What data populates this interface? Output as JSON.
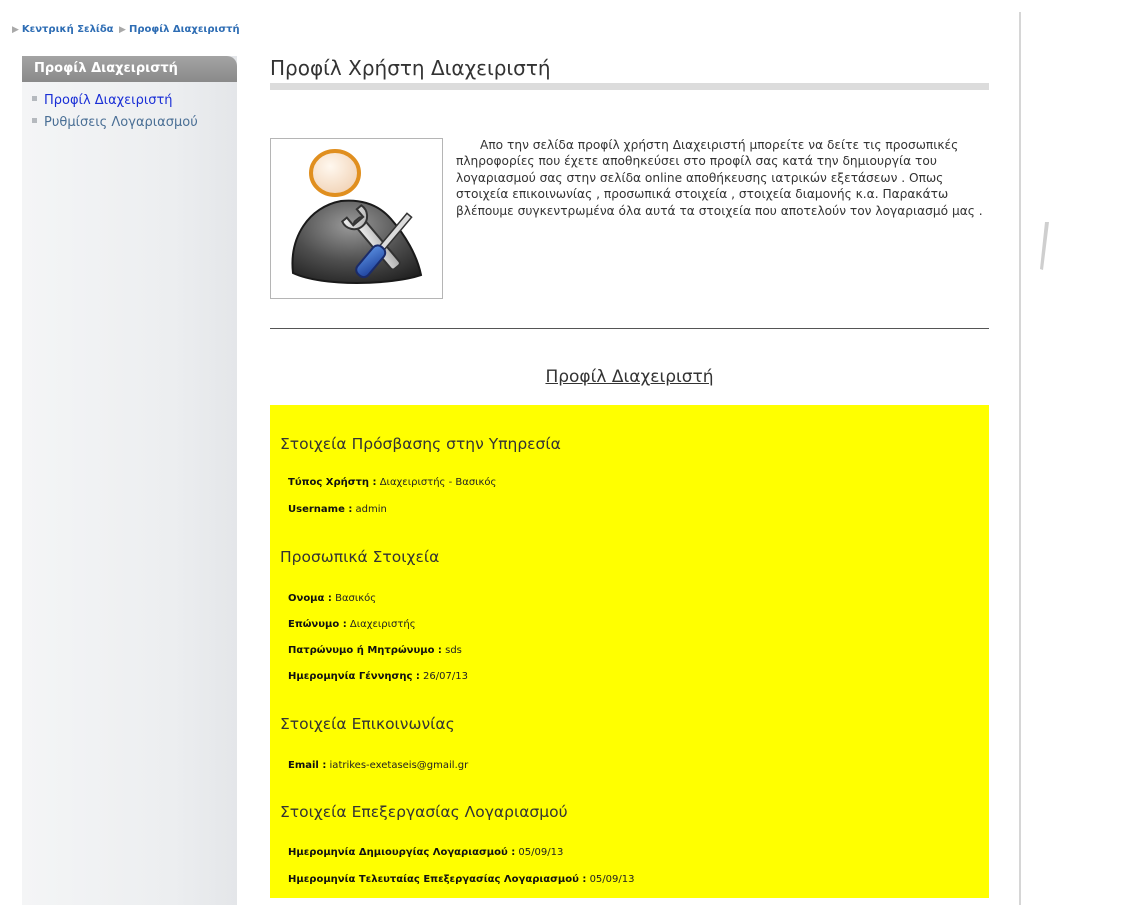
{
  "breadcrumb": {
    "items": [
      "Κεντρική Σελίδα",
      "Προφίλ Διαχειριστή"
    ]
  },
  "sidebar": {
    "title": "Προφίλ Διαχειριστή",
    "items": [
      {
        "label": "Προφίλ Διαχειριστή",
        "active": true
      },
      {
        "label": "Ρυθμίσεις Λογαριασμού",
        "active": false
      }
    ]
  },
  "main": {
    "title": "Προφίλ Χρήστη Διαχειριστή",
    "avatar_icon": "admin-user-tools-icon",
    "intro": "Απο την σελίδα προφίλ χρήστη Διαχειριστή μπορείτε να δείτε τις προσωπικές πληροφορίες που έχετε αποθηκεύσει στο προφίλ σας κατά την δημιουργία του λογαριασμού σας στην σελίδα online αποθήκευσης ιατρικών εξετάσεων . Οπως στοιχεία επικοινωνίας , προσωπικά στοιχεία , στοιχεία διαμονής κ.α. Παρακάτω βλέπουμε συγκεντρωμένα όλα αυτά τα στοιχεία που αποτελούν τον λογαριασμό μας .",
    "profile_heading": "Προφίλ Διαχειριστή"
  },
  "profile": {
    "access": {
      "title": "Στοιχεία Πρόσβασης στην Υπηρεσία",
      "user_type_label": "Τύπος Χρήστη :",
      "user_type_value": "Διαχειριστής - Βασικός",
      "username_label": "Username :",
      "username_value": "admin"
    },
    "personal": {
      "title": "Προσωπικά Στοιχεία",
      "first_name_label": "Ονομα :",
      "first_name_value": "Βασικός",
      "last_name_label": "Επώνυμο :",
      "last_name_value": "Διαχειριστής",
      "parent_name_label": "Πατρώνυμο ή Μητρώνυμο :",
      "parent_name_value": "sds",
      "birth_date_label": "Ημερομηνία Γέννησης :",
      "birth_date_value": "26/07/13"
    },
    "contact": {
      "title": "Στοιχεία Επικοινωνίας",
      "email_label": "Email :",
      "email_value": "iatrikes-exetaseis@gmail.gr"
    },
    "account": {
      "title": "Στοιχεία Επεξεργασίας Λογαριασμού",
      "created_label": "Ημερομηνία Δημιουργίας Λογαριασμού :",
      "created_value": "05/09/13",
      "updated_label": "Ημερομηνία Τελευταίας Επεξεργασίας Λογαριασμού :",
      "updated_value": "05/09/13"
    }
  },
  "colors": {
    "highlight": "#ffff00",
    "link": "#2e6db4",
    "active_link": "#1a2fd6",
    "sidebar_header": "#999999"
  }
}
